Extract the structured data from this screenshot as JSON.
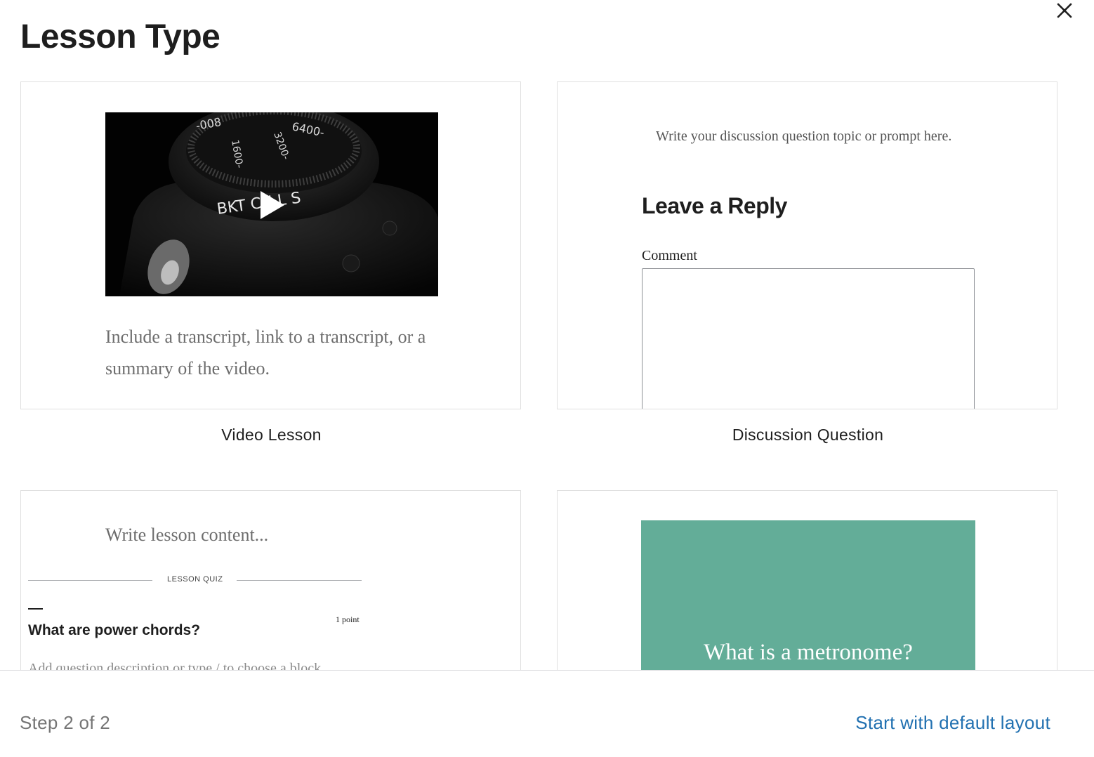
{
  "modal": {
    "title": "Lesson Type",
    "close_icon": "close-icon"
  },
  "patterns": [
    {
      "label": "Video Lesson",
      "preview": {
        "description": "Include a transcript, link to a transcript, or a summary of the video.",
        "thumbnail_icon": "play-icon"
      }
    },
    {
      "label": "Discussion Question",
      "preview": {
        "prompt": "Write your discussion question topic or prompt here.",
        "reply_title": "Leave a Reply",
        "comment_label": "Comment"
      }
    },
    {
      "label": "",
      "preview": {
        "content": "Write lesson content...",
        "separator_label": "LESSON QUIZ",
        "points": "1 point",
        "question": "What are power chords?",
        "question_description": "Add question description or type / to choose a block"
      }
    },
    {
      "label": "",
      "preview": {
        "heading": "What is a metronome?",
        "background_color": "#63ad98"
      }
    }
  ],
  "footer": {
    "step": "Step 2 of 2",
    "default_layout_label": "Start with default layout"
  }
}
